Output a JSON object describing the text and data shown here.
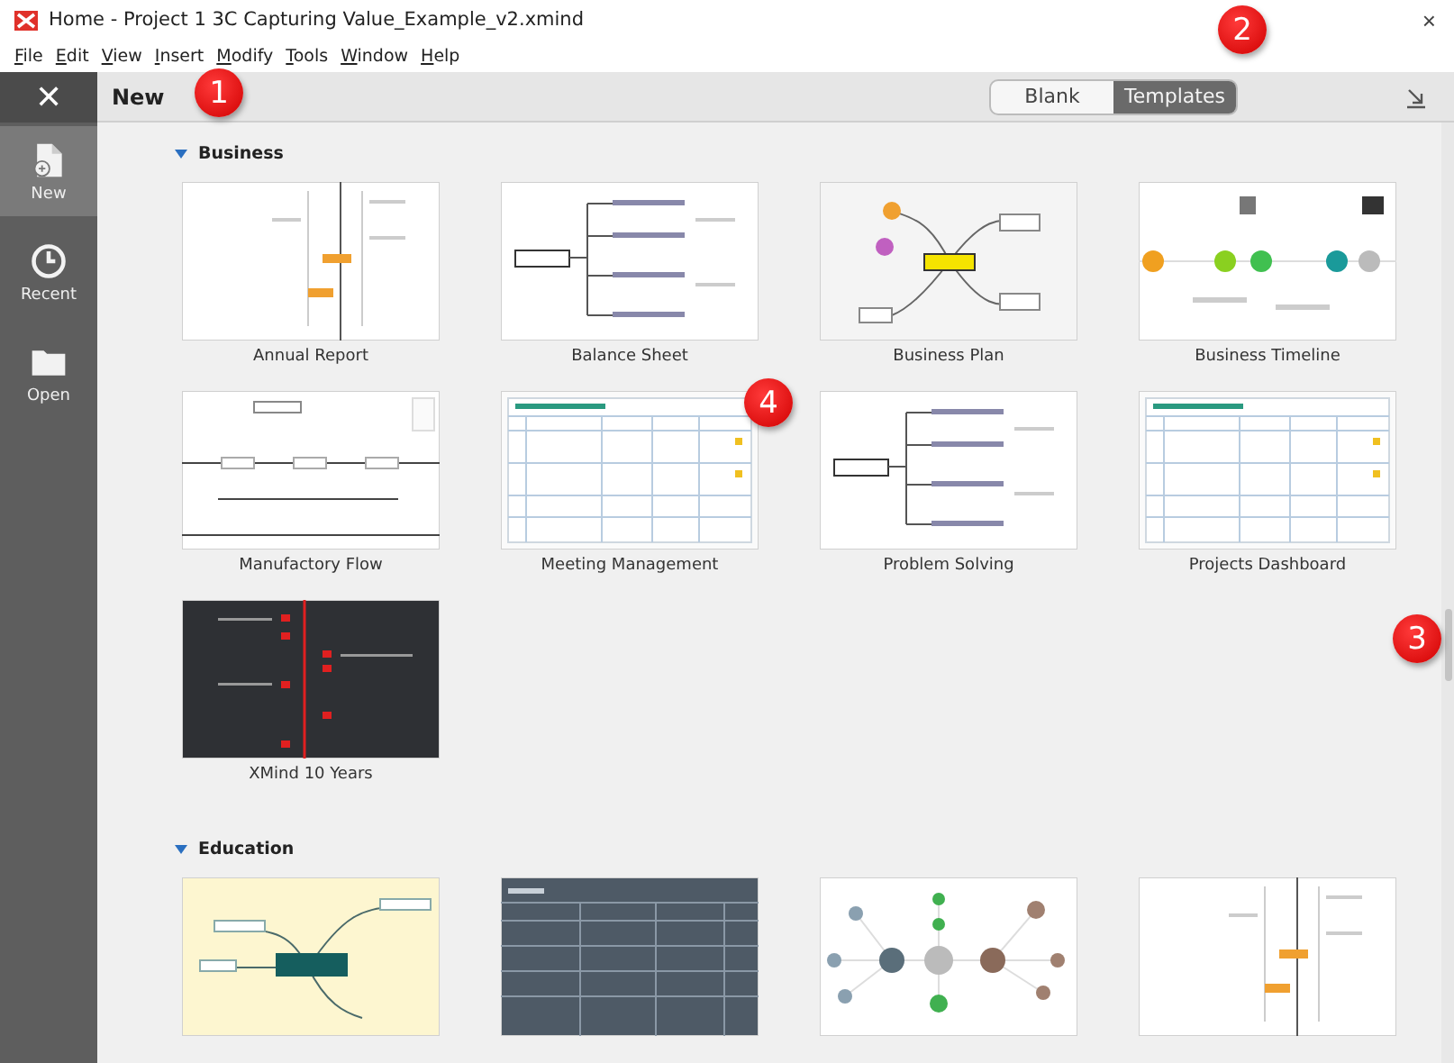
{
  "window": {
    "title": "Home - Project 1 3C Capturing Value_Example_v2.xmind",
    "close": "×"
  },
  "menu": [
    "File",
    "Edit",
    "View",
    "Insert",
    "Modify",
    "Tools",
    "Window",
    "Help"
  ],
  "sidebar": {
    "close": "✕",
    "items": [
      {
        "label": "New",
        "kind": "new",
        "selected": true
      },
      {
        "label": "Recent",
        "kind": "recent",
        "selected": false
      },
      {
        "label": "Open",
        "kind": "open",
        "selected": false
      }
    ]
  },
  "header": {
    "title": "New",
    "toggle": [
      {
        "label": "Blank",
        "selected": false
      },
      {
        "label": "Templates",
        "selected": true
      }
    ]
  },
  "sections": [
    {
      "title": "Business",
      "expanded": true,
      "templates": [
        {
          "label": "Annual Report",
          "kind": "tree"
        },
        {
          "label": "Balance Sheet",
          "kind": "logic"
        },
        {
          "label": "Business Plan",
          "kind": "mindmap"
        },
        {
          "label": "Business Timeline",
          "kind": "timeline"
        },
        {
          "label": "Manufactory Flow",
          "kind": "flow"
        },
        {
          "label": "Meeting Management",
          "kind": "table"
        },
        {
          "label": "Problem Solving",
          "kind": "logic"
        },
        {
          "label": "Projects Dashboard",
          "kind": "table"
        },
        {
          "label": "XMind 10 Years",
          "kind": "dark"
        }
      ]
    },
    {
      "title": "Education",
      "expanded": true,
      "templates": [
        {
          "kind": "cream"
        },
        {
          "kind": "slate"
        },
        {
          "kind": "network"
        },
        {
          "kind": "tree"
        }
      ]
    }
  ],
  "callouts": [
    {
      "text": "1"
    },
    {
      "text": "2"
    },
    {
      "text": "3"
    },
    {
      "text": "4"
    }
  ]
}
